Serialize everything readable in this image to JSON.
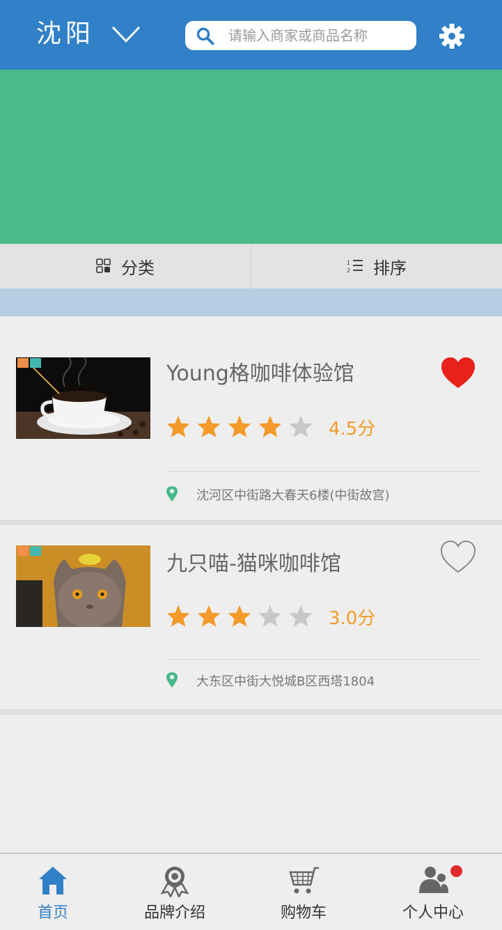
{
  "header": {
    "city": "沈阳",
    "search_placeholder": "请输入商家或商品名称"
  },
  "filters": {
    "category_label": "分类",
    "sort_label": "排序"
  },
  "stores": [
    {
      "name": "Young格咖啡体验馆",
      "rating": 4.5,
      "stars_filled": 4,
      "score_text": "4.5分",
      "address": "沈河区中街路大春天6楼(中街故宫)",
      "favorited": true
    },
    {
      "name": "九只喵-猫咪咖啡馆",
      "rating": 3.0,
      "stars_filled": 3,
      "score_text": "3.0分",
      "address": "大东区中街大悦城B区西塔1804",
      "favorited": false
    }
  ],
  "tabbar": {
    "items": [
      {
        "label": "首页",
        "icon": "home-icon",
        "active": true
      },
      {
        "label": "品牌介绍",
        "icon": "brand-badge-icon",
        "active": false
      },
      {
        "label": "购物车",
        "icon": "cart-icon",
        "active": false
      },
      {
        "label": "个人中心",
        "icon": "user-group-icon",
        "active": false,
        "has_badge": true
      }
    ]
  },
  "colors": {
    "header": "#3180c8",
    "banner": "#4ab98c",
    "star_filled": "#f39a2a",
    "star_empty": "#c8c8c8",
    "heart_active": "#e8211c",
    "pin": "#4ab98c",
    "badge": "#e02a2a"
  }
}
